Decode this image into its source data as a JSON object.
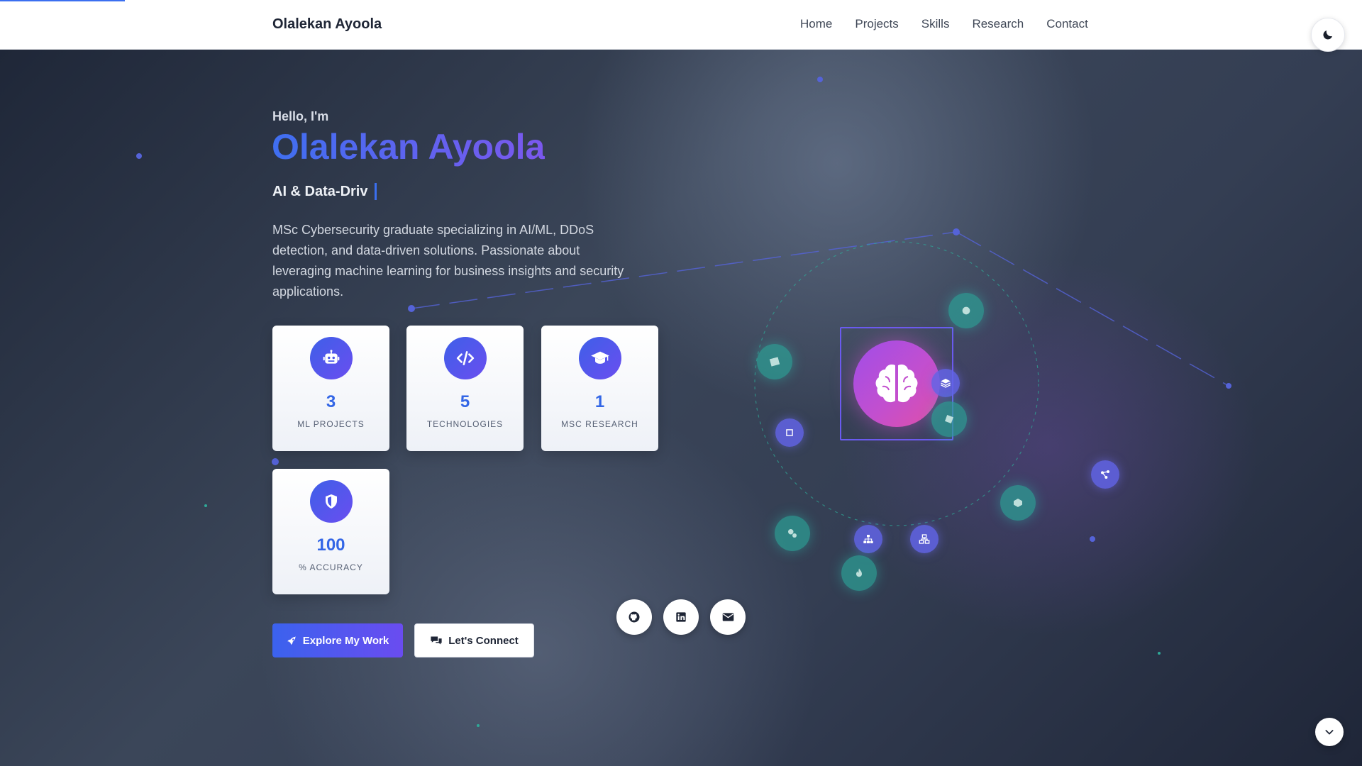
{
  "nav": {
    "brand": "Olalekan Ayoola",
    "links": [
      "Home",
      "Projects",
      "Skills",
      "Research",
      "Contact"
    ]
  },
  "hero": {
    "greeting": "Hello, I'm",
    "name": "Olalekan Ayoola",
    "typed_text": "AI & Data-Driv",
    "bio": "MSc Cybersecurity graduate specializing in AI/ML, DDoS detection, and data-driven solutions. Passionate about leveraging machine learning for business insights and security applications."
  },
  "stats": [
    {
      "icon": "robot-icon",
      "number": "3",
      "label": "ML Projects"
    },
    {
      "icon": "code-icon",
      "number": "5",
      "label": "Technologies"
    },
    {
      "icon": "graduation-cap-icon",
      "number": "1",
      "label": "MSc Research"
    },
    {
      "icon": "shield-icon",
      "number": "100",
      "label": "% Accuracy"
    }
  ],
  "buttons": {
    "primary": "Explore My Work",
    "secondary": "Let's Connect"
  },
  "social": [
    "github-icon",
    "linkedin-icon",
    "envelope-icon"
  ],
  "colors": {
    "accent_blue": "#3b6ff0",
    "accent_violet": "#6a4cf0",
    "brain_gradient": "#c24fcf",
    "teal_node": "#2ca096"
  }
}
